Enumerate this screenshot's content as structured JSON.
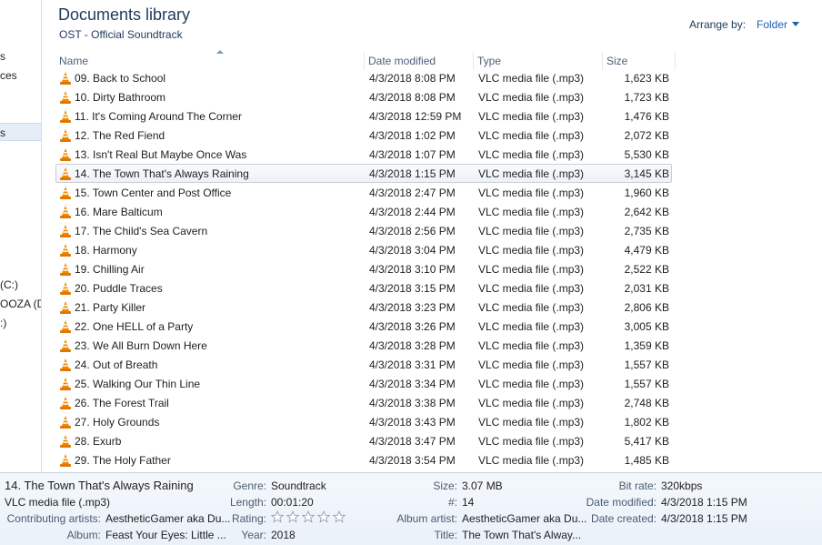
{
  "nav": {
    "items": [
      {
        "label": "s",
        "selected": false
      },
      {
        "label": "ces",
        "selected": false
      },
      {
        "label": "s",
        "selected": true
      },
      {
        "label": "(C:)",
        "selected": false
      },
      {
        "label": "OOZA (D",
        "selected": false
      },
      {
        "label": ":)",
        "selected": false
      }
    ]
  },
  "header": {
    "title": "Documents library",
    "subtitle": "OST - Official Soundtrack",
    "arrange_label": "Arrange by:",
    "arrange_value": "Folder"
  },
  "columns": {
    "name": "Name",
    "date": "Date modified",
    "type": "Type",
    "size": "Size"
  },
  "files": [
    {
      "name": "09. Back to School",
      "date": "4/3/2018 8:08 PM",
      "type": "VLC media file (.mp3)",
      "size": "1,623 KB"
    },
    {
      "name": "10. Dirty Bathroom",
      "date": "4/3/2018 8:08 PM",
      "type": "VLC media file (.mp3)",
      "size": "1,723 KB"
    },
    {
      "name": "11. It's Coming Around The Corner",
      "date": "4/3/2018 12:59 PM",
      "type": "VLC media file (.mp3)",
      "size": "1,476 KB"
    },
    {
      "name": "12. The Red Fiend",
      "date": "4/3/2018 1:02 PM",
      "type": "VLC media file (.mp3)",
      "size": "2,072 KB"
    },
    {
      "name": "13. Isn't Real But Maybe Once Was",
      "date": "4/3/2018 1:07 PM",
      "type": "VLC media file (.mp3)",
      "size": "5,530 KB"
    },
    {
      "name": "14. The Town That's Always Raining",
      "date": "4/3/2018 1:15 PM",
      "type": "VLC media file (.mp3)",
      "size": "3,145 KB"
    },
    {
      "name": "15. Town Center and Post Office",
      "date": "4/3/2018 2:47 PM",
      "type": "VLC media file (.mp3)",
      "size": "1,960 KB"
    },
    {
      "name": "16. Mare Balticum",
      "date": "4/3/2018 2:44 PM",
      "type": "VLC media file (.mp3)",
      "size": "2,642 KB"
    },
    {
      "name": "17. The Child's Sea Cavern",
      "date": "4/3/2018 2:56 PM",
      "type": "VLC media file (.mp3)",
      "size": "2,735 KB"
    },
    {
      "name": "18. Harmony",
      "date": "4/3/2018 3:04 PM",
      "type": "VLC media file (.mp3)",
      "size": "4,479 KB"
    },
    {
      "name": "19. Chilling Air",
      "date": "4/3/2018 3:10 PM",
      "type": "VLC media file (.mp3)",
      "size": "2,522 KB"
    },
    {
      "name": "20. Puddle Traces",
      "date": "4/3/2018 3:15 PM",
      "type": "VLC media file (.mp3)",
      "size": "2,031 KB"
    },
    {
      "name": "21. Party Killer",
      "date": "4/3/2018 3:23 PM",
      "type": "VLC media file (.mp3)",
      "size": "2,806 KB"
    },
    {
      "name": "22. One HELL of a Party",
      "date": "4/3/2018 3:26 PM",
      "type": "VLC media file (.mp3)",
      "size": "3,005 KB"
    },
    {
      "name": "23. We All Burn Down Here",
      "date": "4/3/2018 3:28 PM",
      "type": "VLC media file (.mp3)",
      "size": "1,359 KB"
    },
    {
      "name": "24. Out of Breath",
      "date": "4/3/2018 3:31 PM",
      "type": "VLC media file (.mp3)",
      "size": "1,557 KB"
    },
    {
      "name": "25. Walking Our Thin Line",
      "date": "4/3/2018 3:34 PM",
      "type": "VLC media file (.mp3)",
      "size": "1,557 KB"
    },
    {
      "name": "26. The Forest Trail",
      "date": "4/3/2018 3:38 PM",
      "type": "VLC media file (.mp3)",
      "size": "2,748 KB"
    },
    {
      "name": "27. Holy Grounds",
      "date": "4/3/2018 3:43 PM",
      "type": "VLC media file (.mp3)",
      "size": "1,802 KB"
    },
    {
      "name": "28. Exurb",
      "date": "4/3/2018 3:47 PM",
      "type": "VLC media file (.mp3)",
      "size": "5,417 KB"
    },
    {
      "name": "29. The Holy Father",
      "date": "4/3/2018 3:54 PM",
      "type": "VLC media file (.mp3)",
      "size": "1,485 KB"
    }
  ],
  "selected_index": 5,
  "details": {
    "title": "14. The Town That's Always Raining",
    "file_type": "VLC media file (.mp3)",
    "contributing_artists_label": "Contributing artists:",
    "contributing_artists": "AestheticGamer aka Du...",
    "album_label": "Album:",
    "album": "Feast Your Eyes: Little ...",
    "genre_label": "Genre:",
    "genre": "Soundtrack",
    "length_label": "Length:",
    "length": "00:01:20",
    "rating_label": "Rating:",
    "rating": 0,
    "rating_max": 5,
    "year_label": "Year:",
    "year": "2018",
    "size_label": "Size:",
    "size": "3.07 MB",
    "track_label": "#:",
    "track": "14",
    "album_artist_label": "Album artist:",
    "album_artist": "AestheticGamer aka Du...",
    "title_label": "Title:",
    "title_value": "The Town That's Alway...",
    "bitrate_label": "Bit rate:",
    "bitrate": "320kbps",
    "date_modified_label": "Date modified:",
    "date_modified": "4/3/2018 1:15 PM",
    "date_created_label": "Date created:",
    "date_created": "4/3/2018 1:15 PM"
  },
  "icons": {
    "file_icon": "vlc-cone-icon",
    "rating_icon": "star-icon",
    "sort_icon": "sort-ascending-icon",
    "dropdown_icon": "chevron-down-icon"
  },
  "colors": {
    "title_blue": "#1e395b",
    "link_blue": "#1e5fb4",
    "vlc_orange": "#f08a00"
  }
}
